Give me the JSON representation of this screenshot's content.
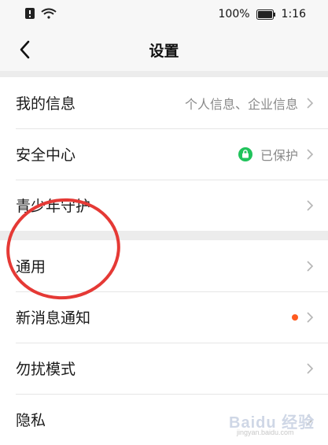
{
  "status_bar": {
    "battery_percent": "100%",
    "time": "1:16",
    "icons": [
      "notification-icon",
      "wifi-icon",
      "battery-icon"
    ]
  },
  "nav": {
    "title": "设置",
    "back_icon": "chevron-left-icon"
  },
  "groups": [
    {
      "rows": [
        {
          "label": "我的信息",
          "value": "个人信息、企业信息"
        },
        {
          "label": "安全中心",
          "value": "已保护",
          "badge": "lock-icon"
        },
        {
          "label": "青少年守护"
        }
      ]
    },
    {
      "rows": [
        {
          "label": "通用"
        },
        {
          "label": "新消息通知",
          "dot": true
        },
        {
          "label": "勿扰模式"
        },
        {
          "label": "隐私"
        }
      ]
    }
  ],
  "annotation": {
    "shape": "red circle around 通用",
    "color": "#e53935"
  },
  "watermark": {
    "text": "Baidu 经验",
    "sub": "jingyan.baidu.com"
  },
  "colors": {
    "accent_green": "#20c35b",
    "dot_orange": "#ff5a1f"
  }
}
